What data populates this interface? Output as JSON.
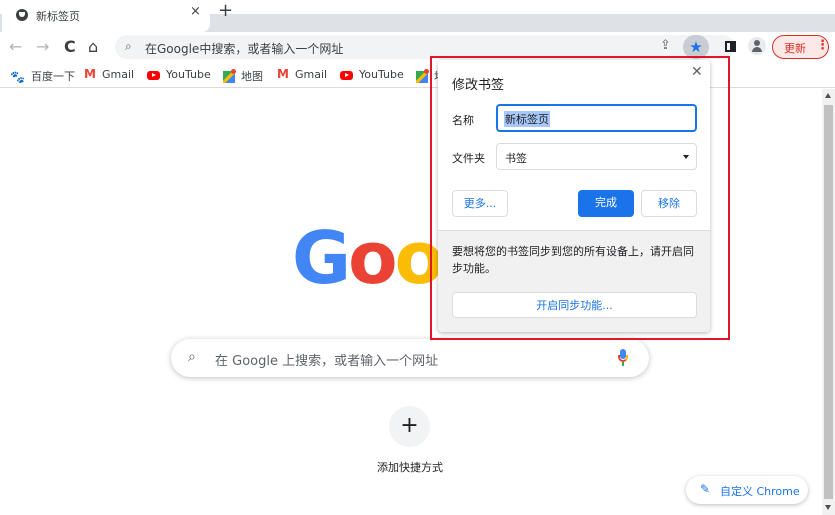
{
  "tab": {
    "title": "新标签页",
    "close": "×",
    "new_tab": "+"
  },
  "toolbar": {
    "back": "←",
    "forward": "→",
    "reload": "C",
    "home": "⌂",
    "search_icon": "🔍",
    "omnibox_placeholder": "在Google中搜索，或者输入一个网址",
    "share": "⇪",
    "star": "★",
    "update_label": "更新",
    "menu": "⋮"
  },
  "bookmarks": [
    {
      "icon": "baidu-icon",
      "label": "百度一下"
    },
    {
      "icon": "gmail-icon",
      "label": "Gmail"
    },
    {
      "icon": "youtube-icon",
      "label": "YouTube"
    },
    {
      "icon": "maps-icon",
      "label": "地图"
    },
    {
      "icon": "gmail-icon",
      "label": "Gmail"
    },
    {
      "icon": "youtube-icon",
      "label": "YouTube"
    },
    {
      "icon": "maps-icon",
      "label": "地"
    }
  ],
  "ntp": {
    "logo": [
      "G",
      "o",
      "o"
    ],
    "search_placeholder": "在 Google 上搜索，或者输入一个网址",
    "add_shortcut_icon": "+",
    "add_shortcut_label": "添加快捷方式",
    "customize_icon": "✎",
    "customize_label": "自定义 Chrome"
  },
  "dialog": {
    "title": "修改书签",
    "close": "✕",
    "name_label": "名称",
    "name_value": "新标签页",
    "folder_label": "文件夹",
    "folder_value": "书签",
    "more_button": "更多...",
    "done_button": "完成",
    "remove_button": "移除",
    "sync_message": "要想将您的书签同步到您的所有设备上，请开启同步功能。",
    "sync_button": "开启同步功能..."
  },
  "colors": {
    "accent": "#1a73e8",
    "update": "#d93025",
    "highlight": "#e0162b"
  }
}
